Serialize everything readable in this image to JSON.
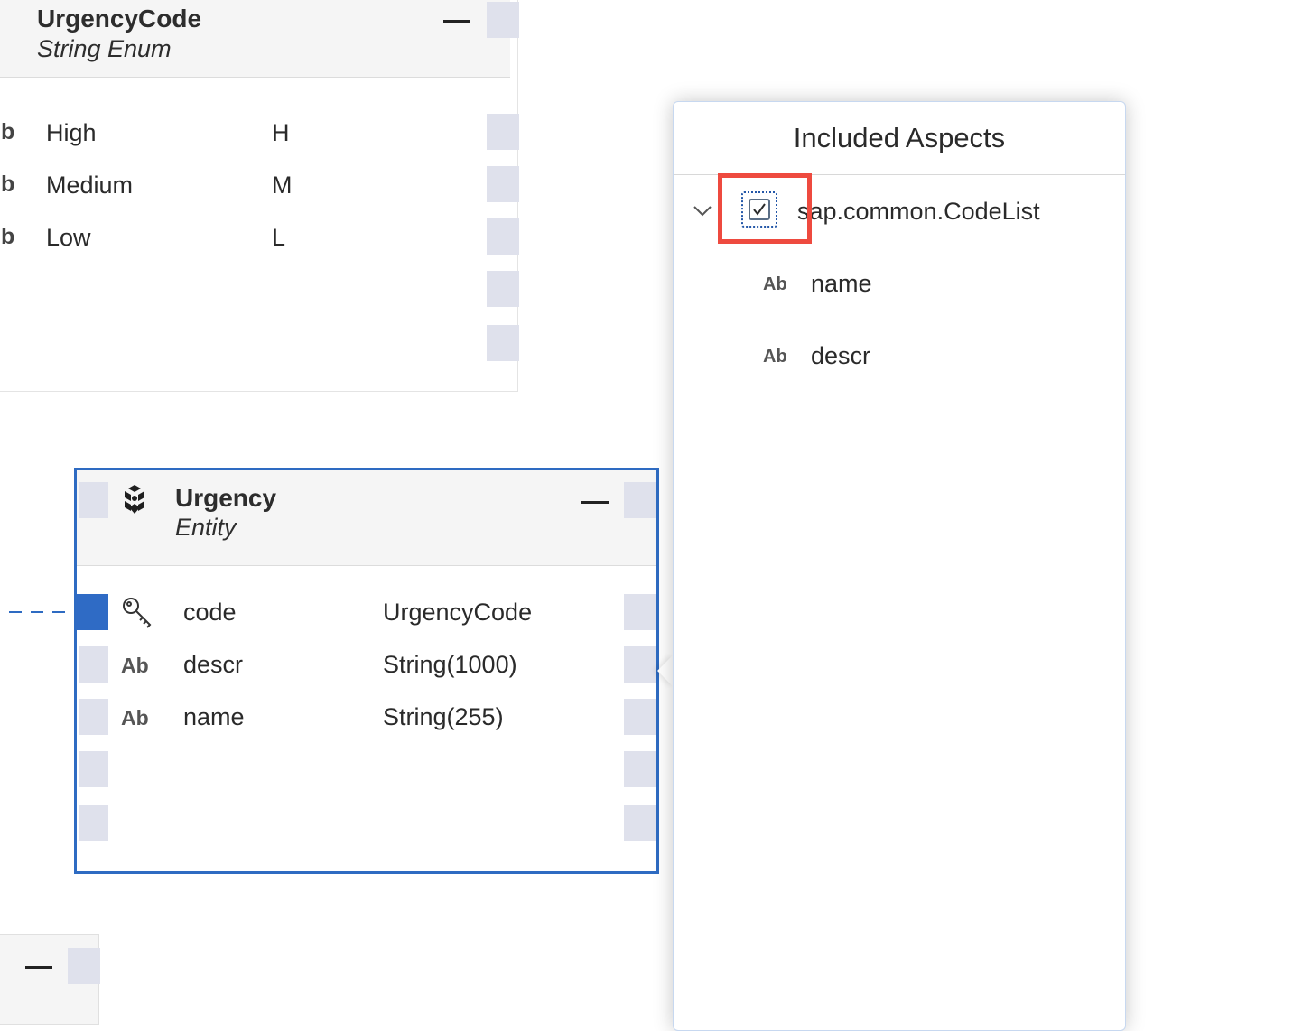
{
  "enum_card": {
    "title": "UrgencyCode",
    "subtitle": "String Enum",
    "rows": [
      {
        "glyph": "b",
        "name": "High",
        "value": "H"
      },
      {
        "glyph": "b",
        "name": "Medium",
        "value": "M"
      },
      {
        "glyph": "b",
        "name": "Low",
        "value": "L"
      }
    ]
  },
  "entity_card": {
    "title": "Urgency",
    "subtitle": "Entity",
    "rows": [
      {
        "icon": "key-icon",
        "name": "code",
        "type": "UrgencyCode"
      },
      {
        "icon": "Ab",
        "name": "descr",
        "type": "String(1000)"
      },
      {
        "icon": "Ab",
        "name": "name",
        "type": "String(255)"
      }
    ]
  },
  "aspects_popover": {
    "title": "Included Aspects",
    "aspect": {
      "name": "sap.common.CodeList",
      "checked": true,
      "expanded": true,
      "children": [
        {
          "icon": "Ab",
          "name": "name"
        },
        {
          "icon": "Ab",
          "name": "descr"
        }
      ]
    }
  },
  "colors": {
    "accent_border": "#2e6bc2",
    "highlight": "#ee4a3f",
    "port": "#dfe1ec",
    "key_port": "#2f6bc5"
  }
}
